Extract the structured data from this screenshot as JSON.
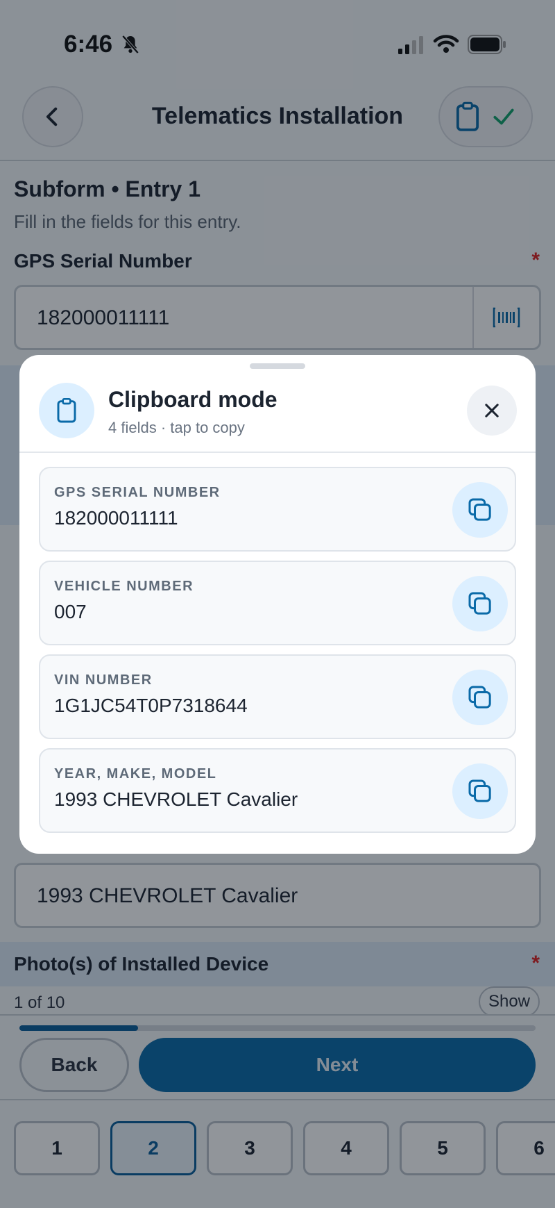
{
  "status_bar": {
    "time": "6:46"
  },
  "header": {
    "title": "Telematics Installation"
  },
  "form": {
    "subtitle": "Subform • Entry 1",
    "description": "Fill in the fields for this entry.",
    "gps_label": "GPS Serial Number",
    "gps_value": "182000011111",
    "required_mark": "*",
    "year_make_model_value": "1993 CHEVROLET Cavalier",
    "photo_label": "Photo(s) of Installed Device",
    "photo_count": "1 of 10",
    "show_label": "Show"
  },
  "nav": {
    "back_label": "Back",
    "next_label": "Next",
    "progress_fraction": 0.23,
    "steps": [
      "1",
      "2",
      "3",
      "4",
      "5",
      "6"
    ],
    "active_step": "2"
  },
  "modal": {
    "title": "Clipboard mode",
    "subtitle": "4 fields · tap to copy",
    "items": [
      {
        "label": "GPS SERIAL NUMBER",
        "value": "182000011111"
      },
      {
        "label": "VEHICLE NUMBER",
        "value": "007"
      },
      {
        "label": "VIN NUMBER",
        "value": "1G1JC54T0P7318644"
      },
      {
        "label": "YEAR, MAKE, MODEL",
        "value": "1993 CHEVROLET Cavalier"
      }
    ]
  },
  "colors": {
    "accent": "#0a6aa8",
    "required": "#dd2222",
    "icon_bg": "#dcefff"
  }
}
